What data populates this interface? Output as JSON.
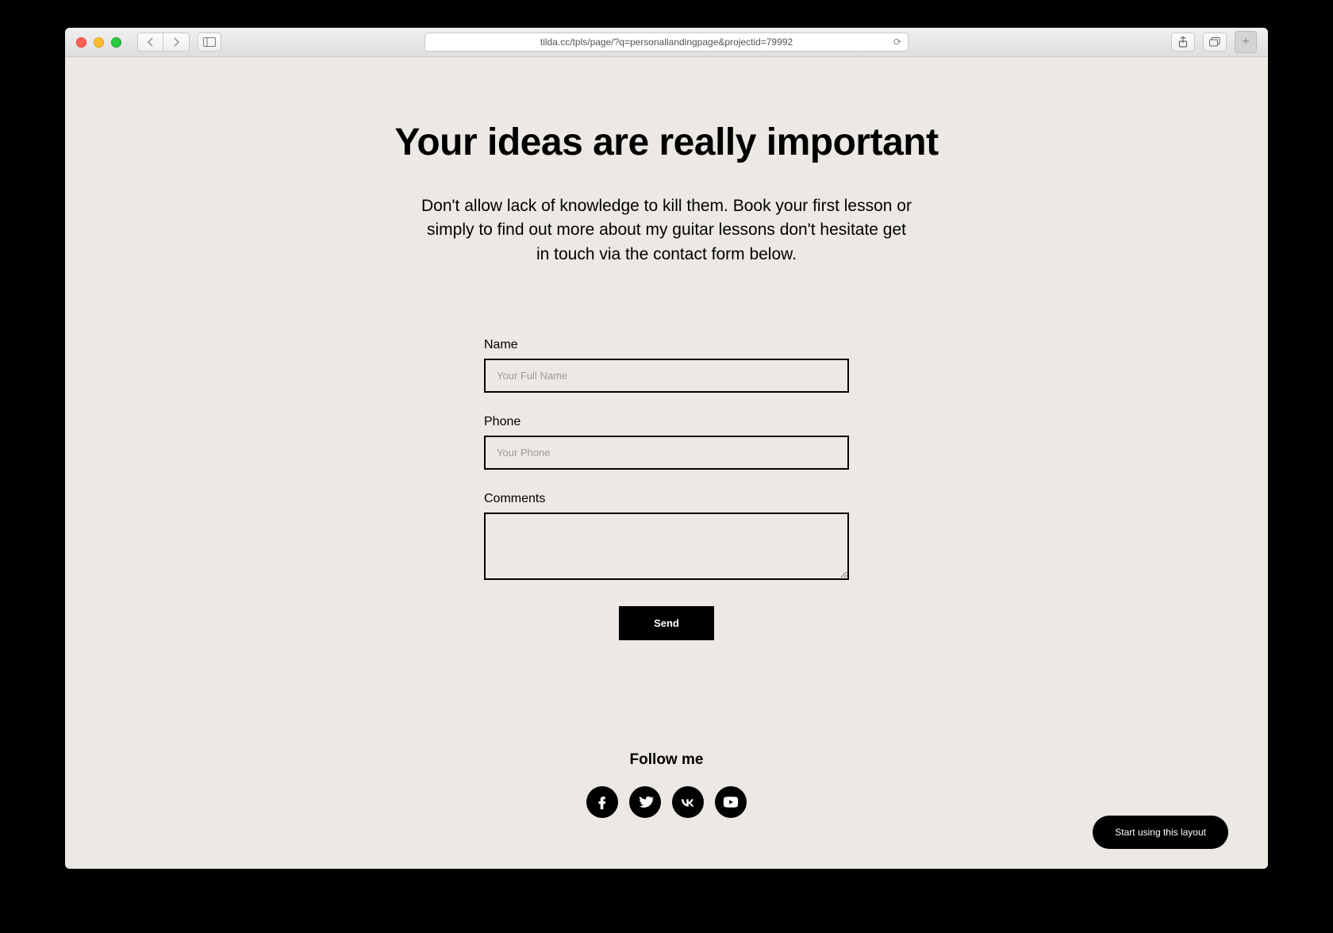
{
  "browser": {
    "url": "tilda.cc/tpls/page/?q=personallandingpage&projectid=79992"
  },
  "hero": {
    "title": "Your ideas are really important",
    "subtitle": "Don't allow lack of knowledge to kill them. Book your first lesson or simply to find out more about my guitar lessons don't hesitate get in touch via the contact form below."
  },
  "form": {
    "name_label": "Name",
    "name_placeholder": "Your Full Name",
    "phone_label": "Phone",
    "phone_placeholder": "Your Phone",
    "comments_label": "Comments",
    "send_label": "Send"
  },
  "follow": {
    "title": "Follow me"
  },
  "cta": {
    "label": "Start using this layout"
  }
}
